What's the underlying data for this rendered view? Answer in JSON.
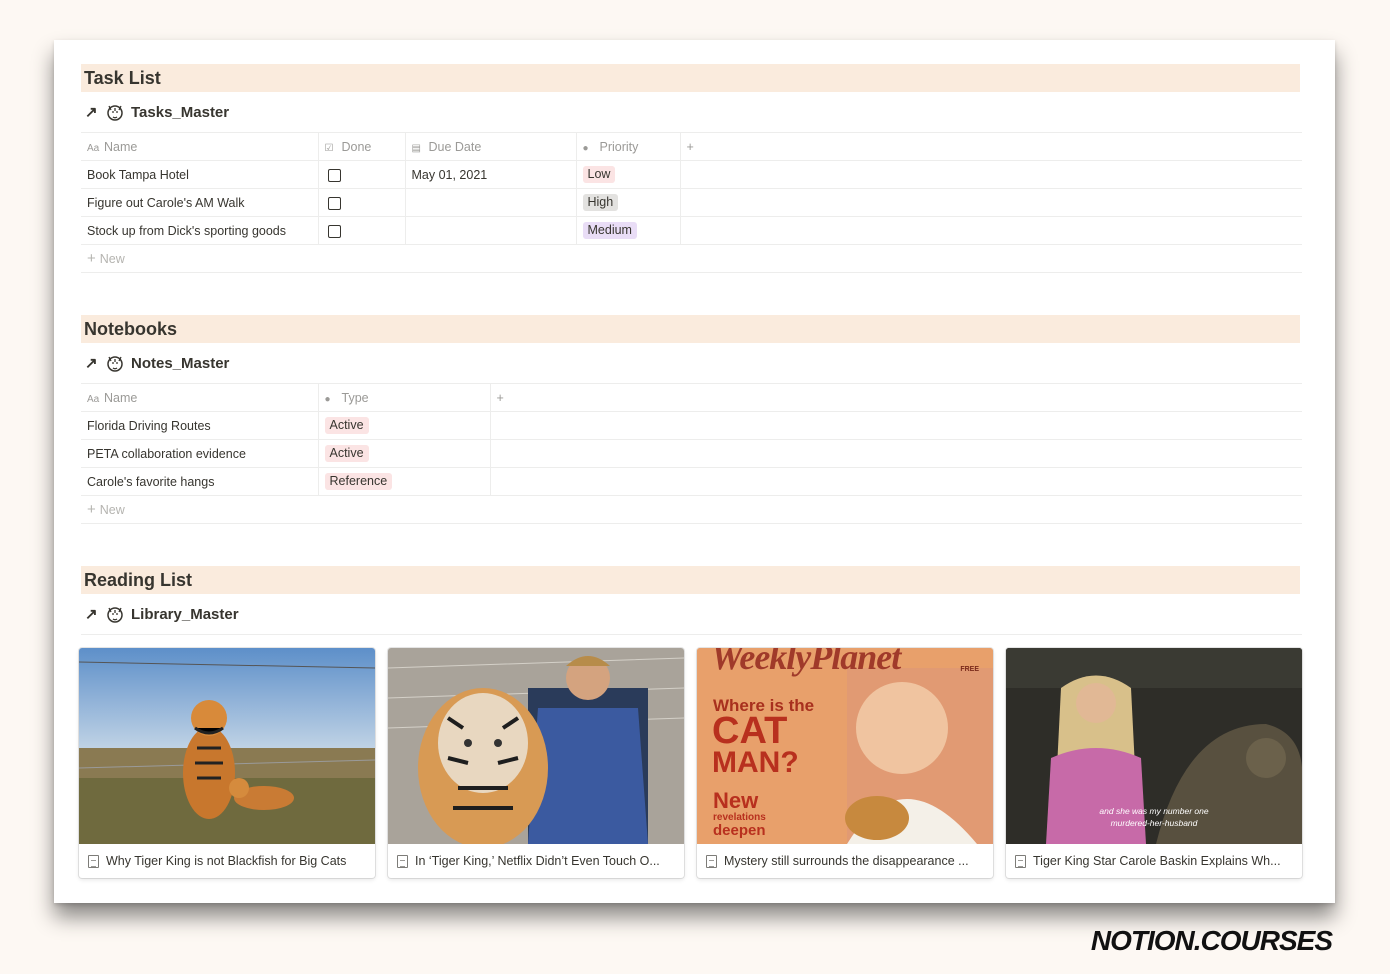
{
  "task_section": {
    "title": "Task List",
    "db_name": "Tasks_Master",
    "columns": {
      "name": "Name",
      "done": "Done",
      "due": "Due Date",
      "priority": "Priority"
    },
    "rows": [
      {
        "name": "Book Tampa Hotel",
        "done": false,
        "due": "May 01, 2021",
        "priority": "Low",
        "priority_bg": "#fbe4e4"
      },
      {
        "name": "Figure out Carole's AM Walk",
        "done": false,
        "due": "",
        "priority": "High",
        "priority_bg": "#e3e2e0"
      },
      {
        "name": "Stock up from Dick's sporting goods",
        "done": false,
        "due": "",
        "priority": "Medium",
        "priority_bg": "#e9ddf6"
      }
    ],
    "new_label": "New"
  },
  "notes_section": {
    "title": "Notebooks",
    "db_name": "Notes_Master",
    "columns": {
      "name": "Name",
      "type": "Type"
    },
    "rows": [
      {
        "name": "Florida Driving Routes",
        "type": "Active"
      },
      {
        "name": "PETA collaboration evidence",
        "type": "Active"
      },
      {
        "name": "Carole's favorite hangs",
        "type": "Reference"
      }
    ],
    "new_label": "New"
  },
  "reading_section": {
    "title": "Reading List",
    "db_name": "Library_Master",
    "cards": [
      {
        "title": "Why Tiger King is not Blackfish for Big Cats"
      },
      {
        "title": "In ‘Tiger King,’ Netflix Didn’t Even Touch O..."
      },
      {
        "title": "Mystery still surrounds the disappearance ...",
        "cover_text": {
          "masthead": "WeeklyPlanet",
          "headline1": "Where is the",
          "headline2": "CAT",
          "headline3": "MAN?",
          "sub1": "New",
          "sub2": "revelations",
          "sub3": "deepen",
          "free": "FREE"
        }
      },
      {
        "title": "Tiger King Star Carole Baskin Explains Wh...",
        "cover_text": {
          "caption1": "and she was my number one",
          "caption2": "murdered-her-husband"
        }
      }
    ]
  },
  "brand": "NOTION.COURSES",
  "colors": {
    "section_bg": "#faebdd",
    "tag_red": "#fbe4e4"
  }
}
